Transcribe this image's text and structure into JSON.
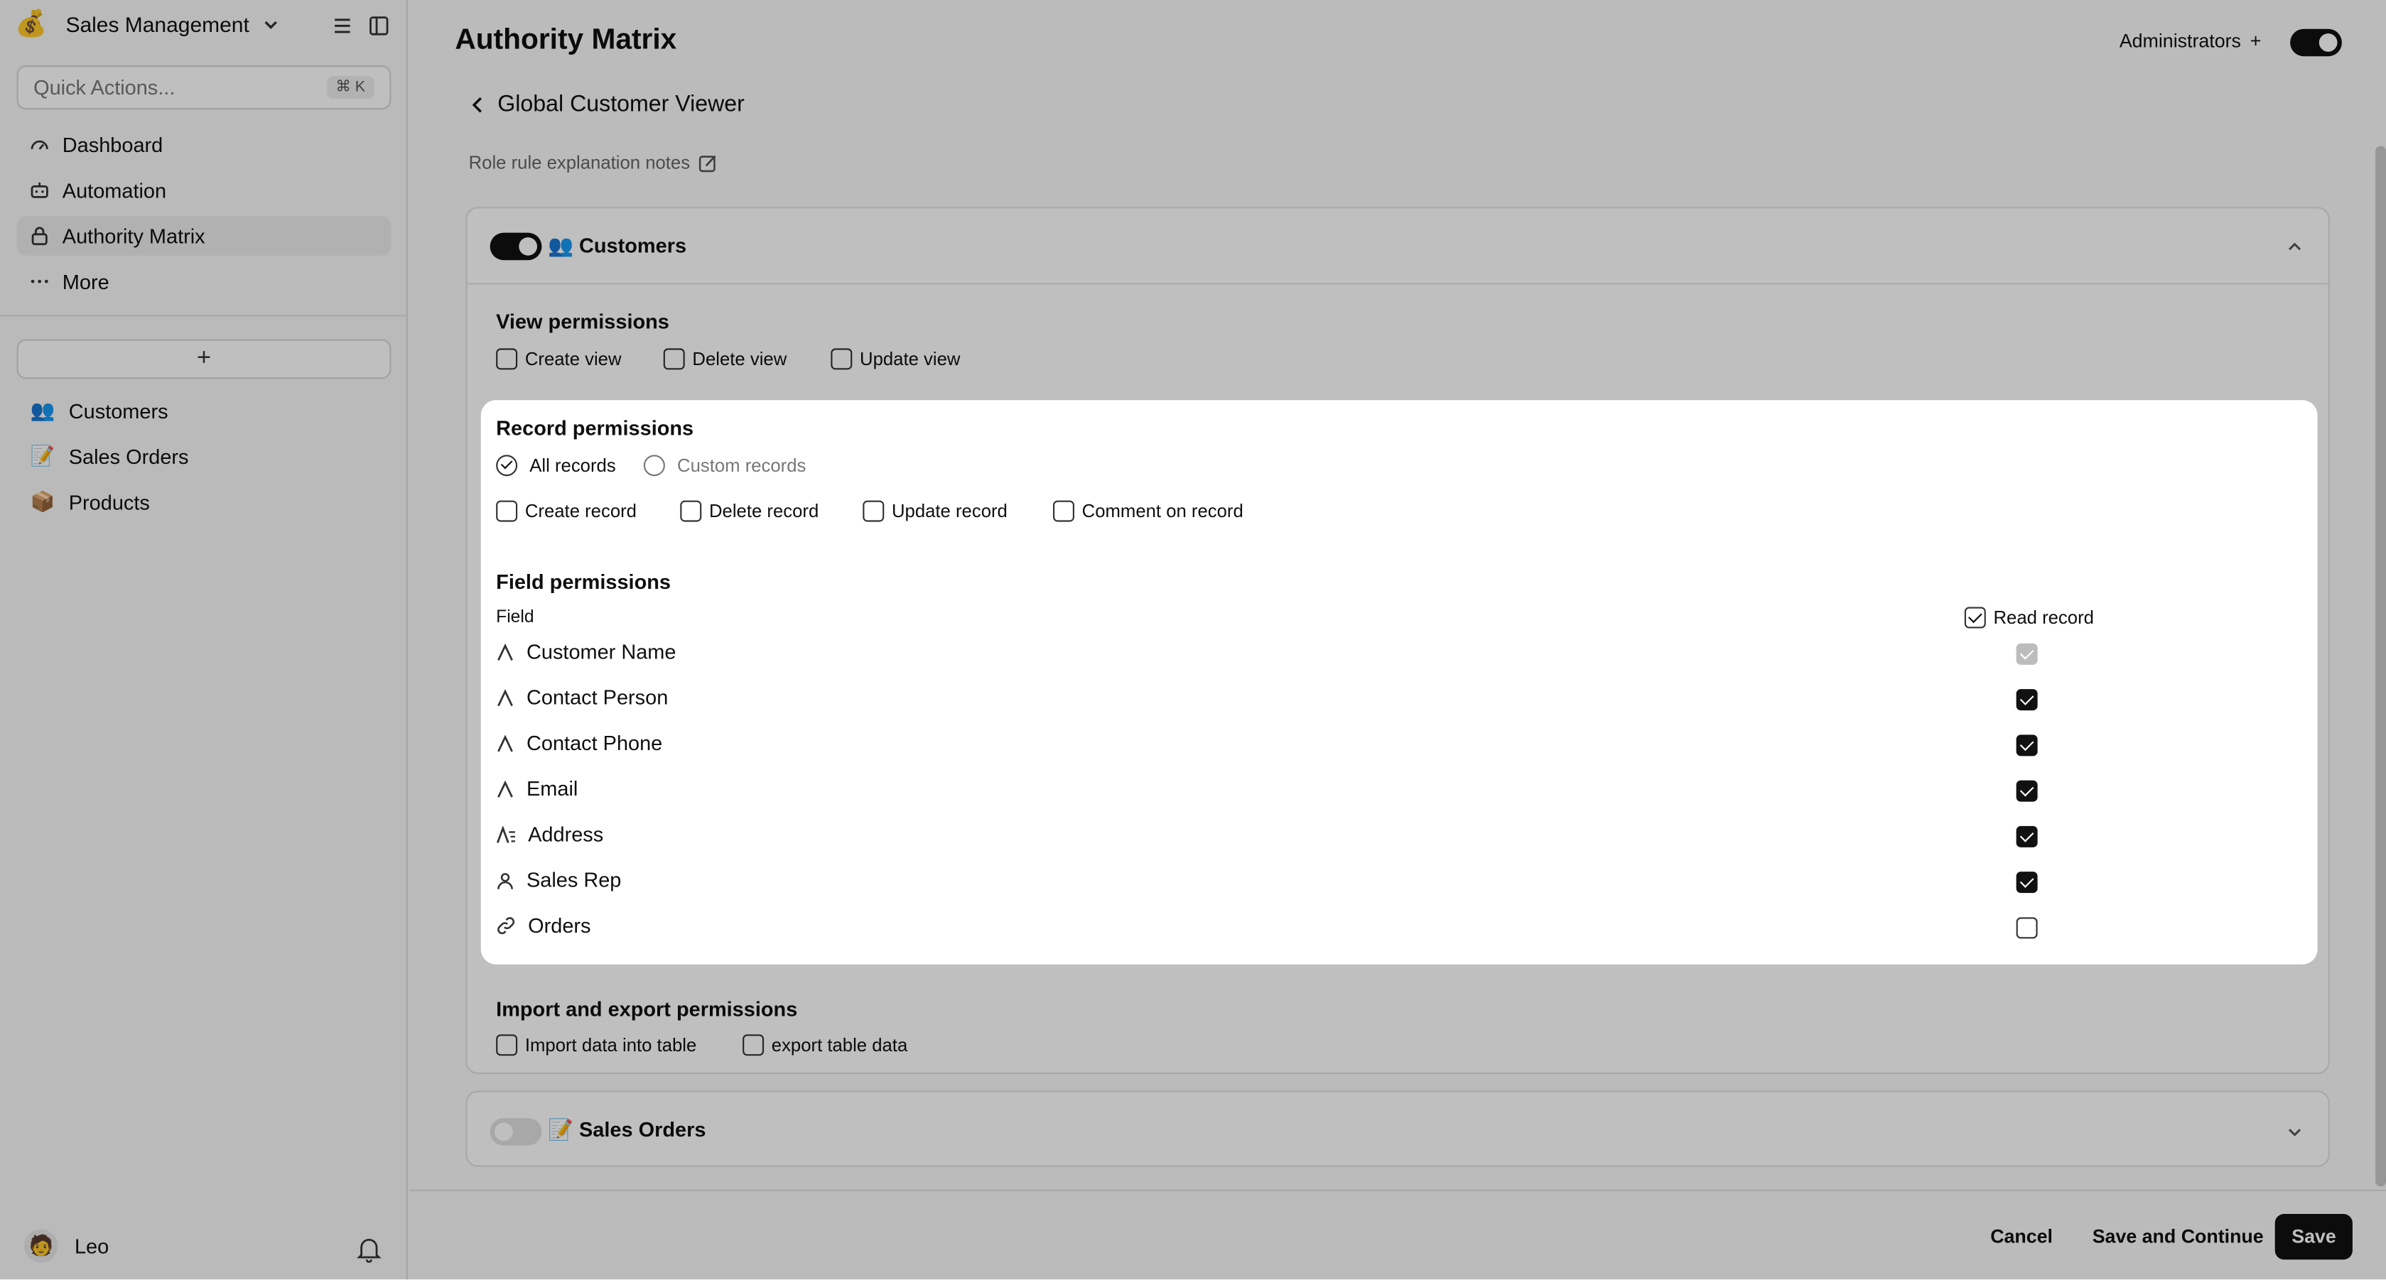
{
  "workspace": {
    "name": "Sales Management",
    "logo": "money-bag-icon"
  },
  "quick_actions": {
    "placeholder": "Quick Actions...",
    "shortcut": "⌘ K"
  },
  "nav": [
    {
      "label": "Dashboard",
      "icon": "dashboard-icon"
    },
    {
      "label": "Automation",
      "icon": "robot-icon"
    },
    {
      "label": "Authority Matrix",
      "icon": "lock-icon",
      "selected": true
    },
    {
      "label": "More",
      "icon": "ellipsis-icon"
    }
  ],
  "tables": [
    {
      "label": "Customers",
      "emoji": "👥"
    },
    {
      "label": "Sales Orders",
      "emoji": "📝"
    },
    {
      "label": "Products",
      "emoji": "📦"
    }
  ],
  "user": {
    "name": "Leo"
  },
  "header": {
    "title": "Authority Matrix",
    "admins_label": "Administrators"
  },
  "role": {
    "back_label": "Global Customer Viewer",
    "notes": "Role rule explanation notes"
  },
  "customers_card": {
    "title": "👥 Customers",
    "view_title": "View permissions",
    "view_opts": [
      "Create view",
      "Delete view",
      "Update view"
    ],
    "record_title": "Record permissions",
    "all_records": "All records",
    "custom_records": "Custom records",
    "record_opts": [
      "Create record",
      "Delete record",
      "Update record",
      "Comment on record"
    ],
    "field_title": "Field permissions",
    "field_col": "Field",
    "read_col": "Read record",
    "fields": [
      {
        "name": "Customer Name",
        "icon": "text-icon",
        "read": "locked"
      },
      {
        "name": "Contact Person",
        "icon": "text-icon",
        "read": "checked"
      },
      {
        "name": "Contact Phone",
        "icon": "text-icon",
        "read": "checked"
      },
      {
        "name": "Email",
        "icon": "text-icon",
        "read": "checked"
      },
      {
        "name": "Address",
        "icon": "long-text-icon",
        "read": "checked"
      },
      {
        "name": "Sales Rep",
        "icon": "user-icon",
        "read": "checked"
      },
      {
        "name": "Orders",
        "icon": "link-icon",
        "read": "unchecked"
      }
    ],
    "import_title": "Import and export permissions",
    "import_opts": [
      "Import data into table",
      "export table data"
    ]
  },
  "orders_card": {
    "title": "📝 Sales Orders"
  },
  "footer": {
    "cancel": "Cancel",
    "save_continue": "Save and Continue",
    "save": "Save"
  }
}
